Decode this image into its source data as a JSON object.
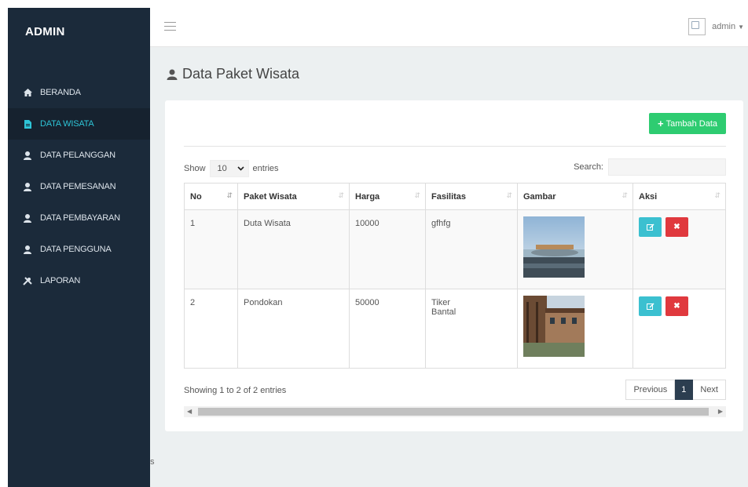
{
  "brand": "ADMIN",
  "nav": [
    {
      "label": "BERANDA",
      "icon": "home-icon",
      "active": false
    },
    {
      "label": "DATA WISATA",
      "icon": "file-icon",
      "active": true
    },
    {
      "label": "DATA PELANGGAN",
      "icon": "user-icon",
      "active": false
    },
    {
      "label": "DATA PEMESANAN",
      "icon": "user-icon",
      "active": false
    },
    {
      "label": "DATA PEMBAYARAN",
      "icon": "user-icon",
      "active": false
    },
    {
      "label": "DATA PENGGUNA",
      "icon": "user-icon",
      "active": false
    },
    {
      "label": "LAPORAN",
      "icon": "wrench-icon",
      "active": false
    }
  ],
  "stray_text": "s",
  "topbar": {
    "user": "admin"
  },
  "page": {
    "title": "Data Paket Wisata"
  },
  "toolbar": {
    "add_label": "Tambah Data"
  },
  "table_controls": {
    "show_label": "Show",
    "entries_value": "10",
    "entries_label": "entries",
    "search_label": "Search:",
    "search_value": ""
  },
  "table": {
    "columns": [
      "No",
      "Paket Wisata",
      "Harga",
      "Fasilitas",
      "Gambar",
      "Aksi"
    ],
    "rows": [
      {
        "no": "1",
        "paket": "Duta Wisata",
        "harga": "10000",
        "fasilitas": [
          "gfhfg"
        ]
      },
      {
        "no": "2",
        "paket": "Pondokan",
        "harga": "50000",
        "fasilitas": [
          "Tiker",
          "Bantal"
        ]
      }
    ]
  },
  "footer": {
    "info": "Showing 1 to 2 of 2 entries",
    "prev": "Previous",
    "page": "1",
    "next": "Next"
  },
  "colors": {
    "sidebar": "#1b2a3a",
    "active_text": "#2ec4d6",
    "add_button": "#2ecc71",
    "edit_button": "#3bc0d0",
    "delete_button": "#e0393e",
    "current_page": "#2c3e50"
  }
}
